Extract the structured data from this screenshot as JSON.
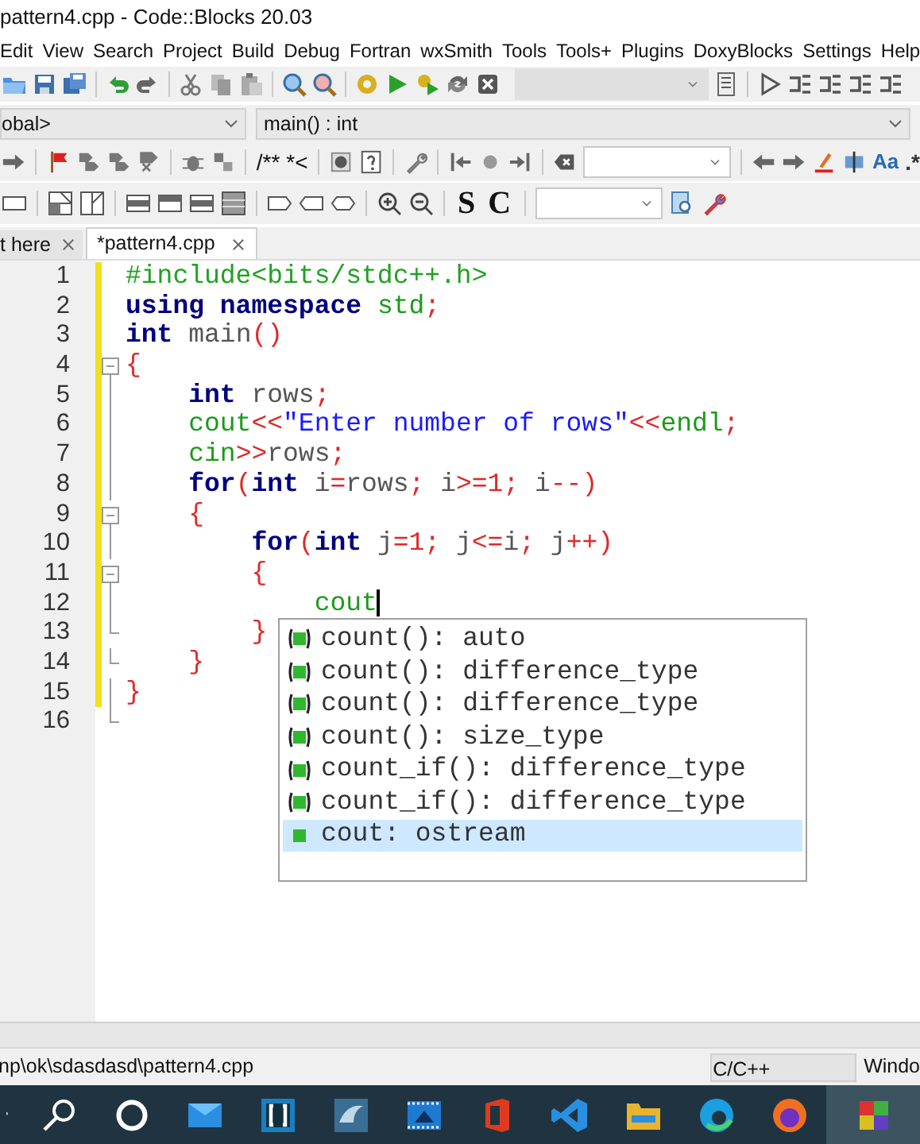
{
  "window": {
    "title": "pattern4.cpp - Code::Blocks 20.03"
  },
  "menu": [
    "Edit",
    "View",
    "Search",
    "Project",
    "Build",
    "Debug",
    "Fortran",
    "wxSmith",
    "Tools",
    "Tools+",
    "Plugins",
    "DoxyBlocks",
    "Settings",
    "Help"
  ],
  "scope_bar": {
    "scope": "obal>",
    "function": "main() : int"
  },
  "toolbar_texts": {
    "doc_comment": "/**",
    "line_comment": "*<",
    "match_case": "Aa",
    "regex": ".*",
    "s_button": "S",
    "c_button": "C"
  },
  "tabs": [
    {
      "label": "t here",
      "selected": false
    },
    {
      "label": "*pattern4.cpp",
      "selected": true
    }
  ],
  "editor": {
    "lines": [
      {
        "number": "1",
        "changed": true,
        "kind": "plain",
        "tokens": [
          {
            "kind": "pre",
            "text": "#include<bits/stdc++.h>"
          }
        ]
      },
      {
        "number": "2",
        "changed": true,
        "kind": "plain",
        "tokens": [
          {
            "kind": "kw",
            "text": "using namespace "
          },
          {
            "kind": "lib",
            "text": "std"
          },
          {
            "kind": "op",
            "text": ";"
          }
        ]
      },
      {
        "number": "3",
        "changed": true,
        "kind": "plain",
        "tokens": [
          {
            "kind": "kw",
            "text": "int "
          },
          {
            "kind": "id",
            "text": "main"
          },
          {
            "kind": "op",
            "text": "()"
          }
        ]
      },
      {
        "number": "4",
        "changed": true,
        "kind": "fold_start",
        "tokens": [
          {
            "kind": "op",
            "text": "{"
          }
        ]
      },
      {
        "number": "5",
        "changed": true,
        "kind": "fold_body",
        "tokens": [
          {
            "kind": "kw",
            "text": "    int "
          },
          {
            "kind": "id",
            "text": "rows"
          },
          {
            "kind": "op",
            "text": ";"
          }
        ]
      },
      {
        "number": "6",
        "changed": true,
        "kind": "fold_body",
        "tokens": [
          {
            "kind": "lib",
            "text": "    cout"
          },
          {
            "kind": "op",
            "text": "<<"
          },
          {
            "kind": "str",
            "text": "\"Enter number of rows\""
          },
          {
            "kind": "op",
            "text": "<<"
          },
          {
            "kind": "lib",
            "text": "endl"
          },
          {
            "kind": "op",
            "text": ";"
          }
        ]
      },
      {
        "number": "7",
        "changed": true,
        "kind": "fold_body",
        "tokens": [
          {
            "kind": "lib",
            "text": "    cin"
          },
          {
            "kind": "op",
            "text": ">>"
          },
          {
            "kind": "id",
            "text": "rows"
          },
          {
            "kind": "op",
            "text": ";"
          }
        ]
      },
      {
        "number": "8",
        "changed": true,
        "kind": "fold_body",
        "tokens": [
          {
            "kind": "kw",
            "text": "    for"
          },
          {
            "kind": "op",
            "text": "("
          },
          {
            "kind": "kw",
            "text": "int "
          },
          {
            "kind": "id",
            "text": "i"
          },
          {
            "kind": "op",
            "text": "="
          },
          {
            "kind": "id",
            "text": "rows"
          },
          {
            "kind": "op",
            "text": "; "
          },
          {
            "kind": "id",
            "text": "i"
          },
          {
            "kind": "op",
            "text": ">="
          },
          {
            "kind": "num",
            "text": "1"
          },
          {
            "kind": "op",
            "text": "; "
          },
          {
            "kind": "id",
            "text": "i"
          },
          {
            "kind": "op",
            "text": "--)"
          }
        ]
      },
      {
        "number": "9",
        "changed": true,
        "kind": "fold_start",
        "tokens": [
          {
            "kind": "op",
            "text": "    {"
          }
        ]
      },
      {
        "number": "10",
        "changed": true,
        "kind": "fold_body",
        "tokens": [
          {
            "kind": "kw",
            "text": "        for"
          },
          {
            "kind": "op",
            "text": "("
          },
          {
            "kind": "kw",
            "text": "int "
          },
          {
            "kind": "id",
            "text": "j"
          },
          {
            "kind": "op",
            "text": "="
          },
          {
            "kind": "num",
            "text": "1"
          },
          {
            "kind": "op",
            "text": "; "
          },
          {
            "kind": "id",
            "text": "j"
          },
          {
            "kind": "op",
            "text": "<="
          },
          {
            "kind": "id",
            "text": "i"
          },
          {
            "kind": "op",
            "text": "; "
          },
          {
            "kind": "id",
            "text": "j"
          },
          {
            "kind": "op",
            "text": "++)"
          }
        ]
      },
      {
        "number": "11",
        "changed": true,
        "kind": "fold_start",
        "tokens": [
          {
            "kind": "op",
            "text": "        {"
          }
        ]
      },
      {
        "number": "12",
        "changed": true,
        "kind": "fold_body",
        "cursor": true,
        "tokens": [
          {
            "kind": "lib",
            "text": "            cout"
          }
        ]
      },
      {
        "number": "13",
        "changed": true,
        "kind": "fold_end",
        "tokens": [
          {
            "kind": "op",
            "text": "        }"
          }
        ]
      },
      {
        "number": "14",
        "changed": true,
        "kind": "fold_end",
        "tokens": [
          {
            "kind": "op",
            "text": "    }"
          }
        ]
      },
      {
        "number": "15",
        "changed": true,
        "kind": "fold_body",
        "tokens": [
          {
            "kind": "op",
            "text": "}"
          }
        ]
      },
      {
        "number": "16",
        "changed": false,
        "kind": "fold_end"
      }
    ]
  },
  "autocomplete": [
    {
      "text": "count(): auto",
      "kind": "function",
      "selected": false
    },
    {
      "text": "count(): difference_type",
      "kind": "function",
      "selected": false
    },
    {
      "text": "count(): difference_type",
      "kind": "function",
      "selected": false
    },
    {
      "text": "count(): size_type",
      "kind": "function",
      "selected": false
    },
    {
      "text": "count_if(): difference_type",
      "kind": "function",
      "selected": false
    },
    {
      "text": "count_if(): difference_type",
      "kind": "function",
      "selected": false
    },
    {
      "text": "cout: ostream",
      "kind": "variable",
      "selected": true
    }
  ],
  "status_bar": {
    "path": "np\\ok\\sdasdasd\\pattern4.cpp",
    "language": "C/C++",
    "extra": "Windo"
  }
}
